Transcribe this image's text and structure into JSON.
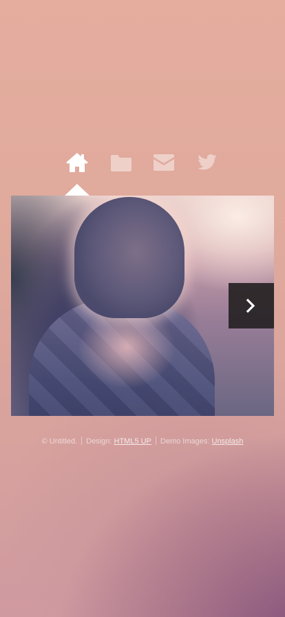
{
  "nav": {
    "items": [
      {
        "icon": "home-icon",
        "active": true
      },
      {
        "icon": "folder-icon",
        "active": false
      },
      {
        "icon": "envelope-icon",
        "active": false
      },
      {
        "icon": "twitter-icon",
        "active": false
      }
    ]
  },
  "slideshow": {
    "next_icon": "chevron-right-icon"
  },
  "footer": {
    "copyright": "© Untitled.",
    "design_label": "Design:",
    "design_link": "HTML5 UP",
    "images_label": "Demo Images:",
    "images_link": "Unsplash"
  },
  "colors": {
    "active_icon": "#ffffff",
    "inactive_icon": "rgba(255,255,255,0.45)",
    "next_button_bg": "#282426"
  }
}
